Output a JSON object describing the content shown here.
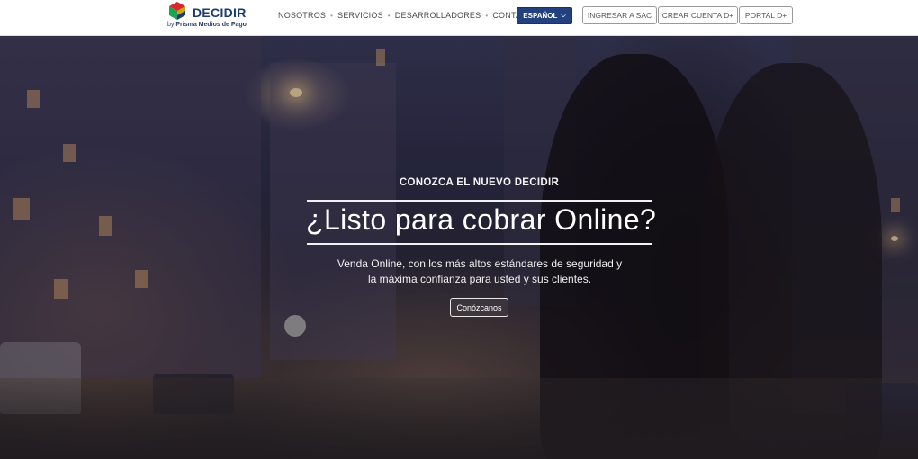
{
  "brand": {
    "name": "DECIDIR",
    "tagline_prefix": "by",
    "tagline_company": "Prisma Medios de Pago"
  },
  "nav": {
    "items": [
      {
        "label": "NOSOTROS"
      },
      {
        "label": "SERVICIOS"
      },
      {
        "label": "DESARROLLADORES"
      },
      {
        "label": "CONTACTO"
      }
    ],
    "separator": "•"
  },
  "language": {
    "label": "ESPAÑOL",
    "icon": "chevron-down-icon"
  },
  "header_buttons": {
    "sac": "INGRESAR A SAC",
    "crear": "CREAR CUENTA D+",
    "portal": "PORTAL D+"
  },
  "hero": {
    "kicker": "CONOZCA EL NUEVO DECIDIR",
    "headline": "¿Listo para cobrar Online?",
    "subtext_line1": "Venda Online, con los más altos estándares de seguridad y",
    "subtext_line2": "la máxima confianza para usted y sus clientes.",
    "cta": "Conózcanos"
  },
  "colors": {
    "brand_blue": "#23407f",
    "logo_text": "#1d3b72",
    "logo_red": "#d9272e",
    "logo_yellow": "#f4b400",
    "logo_green": "#1aa650"
  }
}
